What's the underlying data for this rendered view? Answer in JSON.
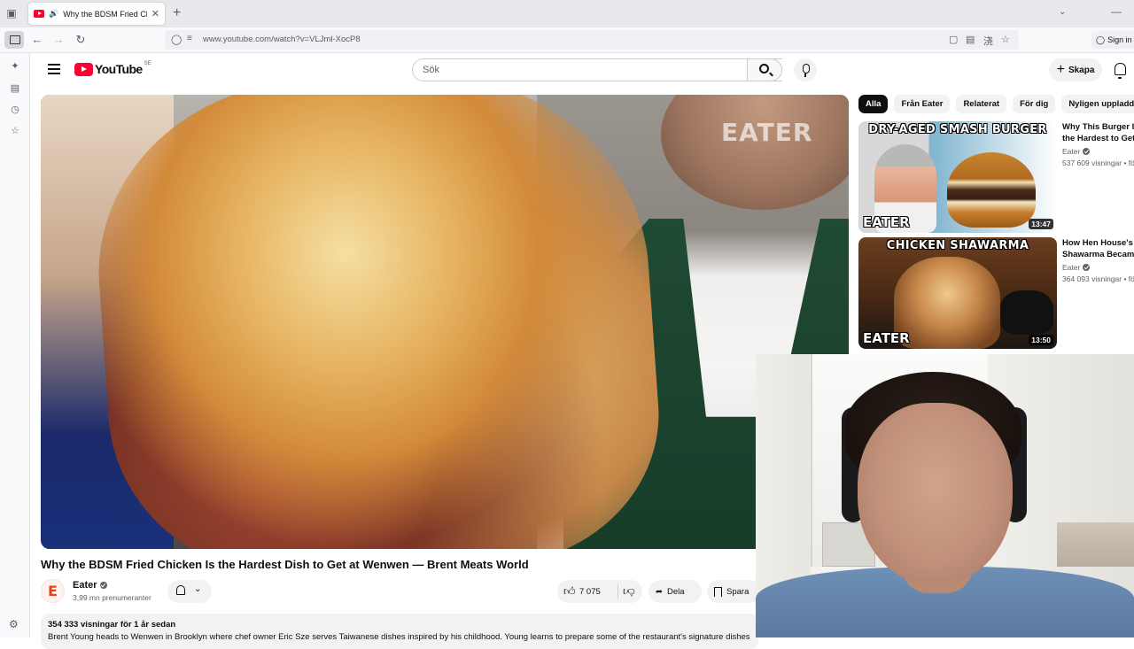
{
  "browser": {
    "tab_title": "Why the BDSM Fried Chické",
    "url": "www.youtube.com/watch?v=VLJml-XocP8",
    "signin_label": "Sign in"
  },
  "header": {
    "logo_text": "YouTube",
    "country_code": "SE",
    "search_placeholder": "Sök",
    "create_label": "Skapa"
  },
  "video": {
    "watermark": "EATER",
    "title": "Why the BDSM Fried Chicken Is the Hardest Dish to Get at Wenwen — Brent Meats World",
    "channel_name": "Eater",
    "channel_initial": "E",
    "subscribers": "3,99 mn prenumeranter",
    "likes": "7 075",
    "share_label": "Dela",
    "save_label": "Spara",
    "views_meta": "354 333 visningar  för 1 år sedan",
    "description": "Brent Young heads to Wenwen in Brooklyn where chef owner Eric Sze serves Taiwanese dishes inspired by his childhood. Young learns to prepare some of the restaurant's signature dishes"
  },
  "chips": [
    "Alla",
    "Från Eater",
    "Relaterat",
    "För dig",
    "Nyligen uppladdat"
  ],
  "recommendations": [
    {
      "thumb_headline": "DRY-AGED SMASH BURGER",
      "thumb_logo": "EATER",
      "duration": "13:47",
      "title_line1": "Why This Burger Is",
      "title_line2": "the Hardest to Get",
      "channel": "Eater",
      "views": "537 609 visningar • fö"
    },
    {
      "thumb_headline": "CHICKEN SHAWARMA",
      "thumb_logo": "EATER",
      "duration": "13:50",
      "title_line1": "How Hen House's C",
      "title_line2": "Shawarma Became",
      "channel": "Eater",
      "views": "364 093 visningar • fö"
    }
  ],
  "colors": {
    "brand_red": "#ff0033",
    "chip_active": "#0f0f0f",
    "text_secondary": "#606060"
  }
}
